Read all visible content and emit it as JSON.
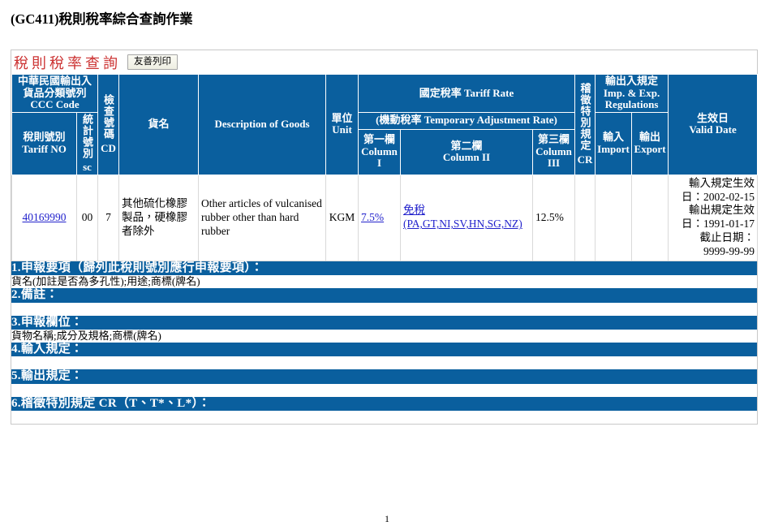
{
  "page": {
    "title_code": "(GC411)",
    "title_text": "稅則稅率綜合查詢作業",
    "page_number": "1"
  },
  "caption": {
    "title": "稅則稅率查詢",
    "print_button": "友善列印"
  },
  "table_header": {
    "ccc_code": "中華民國輸出入貨品分類號列CCC Code",
    "tariff_no": "稅則號別\nTariff NO",
    "sc": "統計號別 sc",
    "sc_vert": "統計號別",
    "sc_latin": "sc",
    "cd_vert": "檢查號碼",
    "cd_latin": "CD",
    "goods_name": "貨名",
    "description": "Description of Goods",
    "unit": "單位\nUnit",
    "unit_zh": "單位",
    "unit_en": "Unit",
    "tariff_rate": "國定稅率 Tariff Rate",
    "temp_rate": "(機動稅率 Temporary Adjustment Rate)",
    "column1_zh": "第一欄",
    "column1_en": "Column",
    "column1_num": "I",
    "column2_zh": "第二欄",
    "column2_en": "Column II",
    "column3_zh": "第三欄",
    "column3_en": "Column",
    "column3_num": "III",
    "cr_vert": "稽徵特別規定",
    "cr_latin": "CR",
    "impexp_regs": "輸出入規定\nImp. & Exp.\nRegulations",
    "impexp_zh": "輸出入規定",
    "impexp_en1": "Imp. & Exp.",
    "impexp_en2": "Regulations",
    "import_zh": "輸入",
    "import_en": "Import",
    "export_zh": "輸出",
    "export_en": "Export",
    "valid_date_zh": "生效日",
    "valid_date_en": "Valid Date"
  },
  "rows": [
    {
      "tariff_no": "40169990",
      "sc": "00",
      "cd": "7",
      "goods_name": "其他硫化橡膠製品，硬橡膠者除外",
      "description": "Other articles of vulcanised rubber other than hard rubber",
      "unit": "KGM",
      "column1": "7.5%",
      "column2_line1": "免稅",
      "column2_line2": "(PA,GT,NI,SV,HN,SG,NZ)",
      "column3": "12.5%",
      "cr": "",
      "import": "",
      "export": "",
      "valid_date_line1": "輸入規定生效",
      "valid_date_line2": "日：2002-02-15",
      "valid_date_line3": "輸出規定生效",
      "valid_date_line4": "日：1991-01-17",
      "valid_date_line5": "截止日期：",
      "valid_date_line6": "9999-99-99"
    }
  ],
  "notes": [
    {
      "heading": "1.申報要項（歸列此稅則號別應行申報要項）：",
      "body": "貨名(加註是否為多孔性);用途;商標(牌名)"
    },
    {
      "heading": "2.備註：",
      "body": ""
    },
    {
      "heading": "3.申報欄位：",
      "body": "貨物名稱;成分及規格;商標(牌名)"
    },
    {
      "heading": "4.輸入規定：",
      "body": ""
    },
    {
      "heading": "5.輸出規定：",
      "body": ""
    },
    {
      "heading": "6.稽徵特別規定 CR（T、T*、L*）：",
      "body": ""
    }
  ],
  "colors": {
    "header_blue": "#0a5f9e",
    "caption_red": "#cc3333",
    "link_blue": "#2222cc",
    "border_gray": "#d9d9d9"
  }
}
